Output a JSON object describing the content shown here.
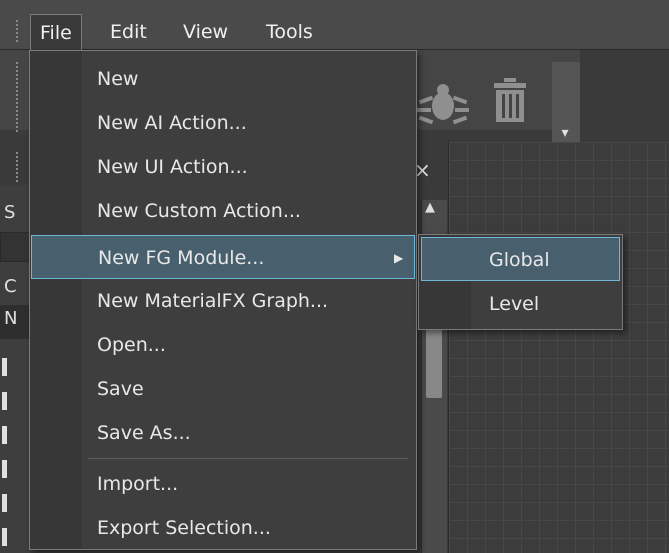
{
  "menubar": {
    "items": [
      {
        "label": "File"
      },
      {
        "label": "Edit"
      },
      {
        "label": "View"
      },
      {
        "label": "Tools"
      }
    ],
    "active": "File"
  },
  "file_menu": {
    "items": [
      {
        "label": "New"
      },
      {
        "label": "New AI Action..."
      },
      {
        "label": "New UI Action..."
      },
      {
        "label": "New Custom Action..."
      },
      {
        "label": "New FG Module...",
        "has_submenu": true,
        "highlighted": true
      },
      {
        "label": "New MaterialFX Graph..."
      },
      {
        "label": "Open..."
      },
      {
        "label": "Save"
      },
      {
        "label": "Save As..."
      },
      {
        "label": "Import..."
      },
      {
        "label": "Export Selection..."
      }
    ],
    "submenu_arrow": "▶"
  },
  "submenu": {
    "items": [
      {
        "label": "Global",
        "highlighted": true
      },
      {
        "label": "Level"
      }
    ]
  },
  "background": {
    "panel_close": "×",
    "panel_letters": [
      "S",
      "C",
      "N"
    ],
    "toolbar_overflow": "▾",
    "scroll_up": "▲",
    "icons": [
      "bug-icon",
      "trash-icon"
    ]
  },
  "colors": {
    "highlight_fill": "#48606e",
    "highlight_border": "#6fb7d8",
    "menu_bg": "#3e3e3e"
  }
}
